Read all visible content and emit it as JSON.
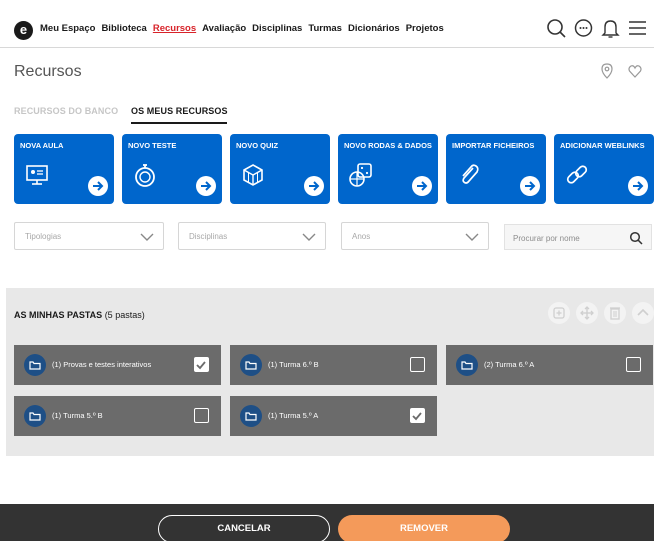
{
  "nav": {
    "logo": "e",
    "items": [
      "Meu Espaço",
      "Biblioteca",
      "Recursos",
      "Avaliação",
      "Disciplinas",
      "Turmas",
      "Dicionários",
      "Projetos"
    ],
    "active_index": 2,
    "icons": [
      "search-icon",
      "chat-icon",
      "bell-icon",
      "menu-icon"
    ]
  },
  "header": {
    "title": "Recursos",
    "icons": [
      "location-pin-icon",
      "heart-icon"
    ]
  },
  "tabs": {
    "bank": "RECURSOS DO BANCO",
    "mine": "OS MEUS RECURSOS",
    "active": "mine"
  },
  "cards": [
    {
      "label": "NOVA AULA",
      "icon": "presentation-icon"
    },
    {
      "label": "NOVO TESTE",
      "icon": "stopwatch-icon"
    },
    {
      "label": "NOVO QUIZ",
      "icon": "cube-icon"
    },
    {
      "label": "NOVO RODAS & DADOS",
      "icon": "dice-icon"
    },
    {
      "label": "IMPORTAR FICHEIROS",
      "icon": "paperclip-icon"
    },
    {
      "label": "ADICIONAR WEBLINKS",
      "icon": "link-icon"
    }
  ],
  "filters": {
    "tipologias": "Tipologias",
    "disciplinas": "Disciplinas",
    "anos": "Anos",
    "search_placeholder": "Procurar por nome"
  },
  "folders_panel": {
    "title": "AS MINHAS PASTAS",
    "count": "(5 pastas)",
    "folders": [
      {
        "name": "(1) Provas e testes interativos",
        "checked": true
      },
      {
        "name": "(1) Turma 6.º B",
        "checked": false
      },
      {
        "name": "(2) Turma 6.º A",
        "checked": false
      },
      {
        "name": "(1) Turma 5.º B",
        "checked": false
      },
      {
        "name": "(1) Turma 5.º A",
        "checked": true
      }
    ]
  },
  "footer": {
    "cancel": "CANCELAR",
    "remove": "REMOVER"
  },
  "colors": {
    "accent_red": "#d8232a",
    "card_blue": "#0066cc",
    "folder_gray": "#6b6b6b",
    "remove_orange": "#f49a5a",
    "footer_dark": "#333333"
  }
}
